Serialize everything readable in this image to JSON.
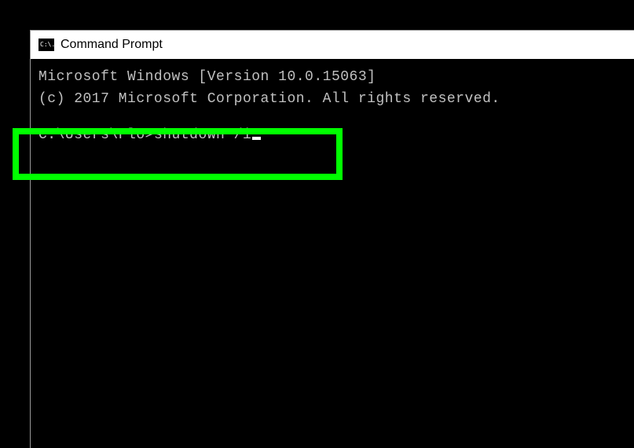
{
  "window": {
    "title": "Command Prompt",
    "icon_text": "C:\\."
  },
  "terminal": {
    "version_line": "Microsoft Windows [Version 10.0.15063]",
    "copyright_line": "(c) 2017 Microsoft Corporation. All rights reserved.",
    "prompt": "C:\\Users\\Flo>",
    "command": "shutdown /i"
  },
  "colors": {
    "highlight": "#00ff00",
    "terminal_bg": "#000000",
    "terminal_fg": "#c0c0c0",
    "titlebar_bg": "#ffffff"
  }
}
